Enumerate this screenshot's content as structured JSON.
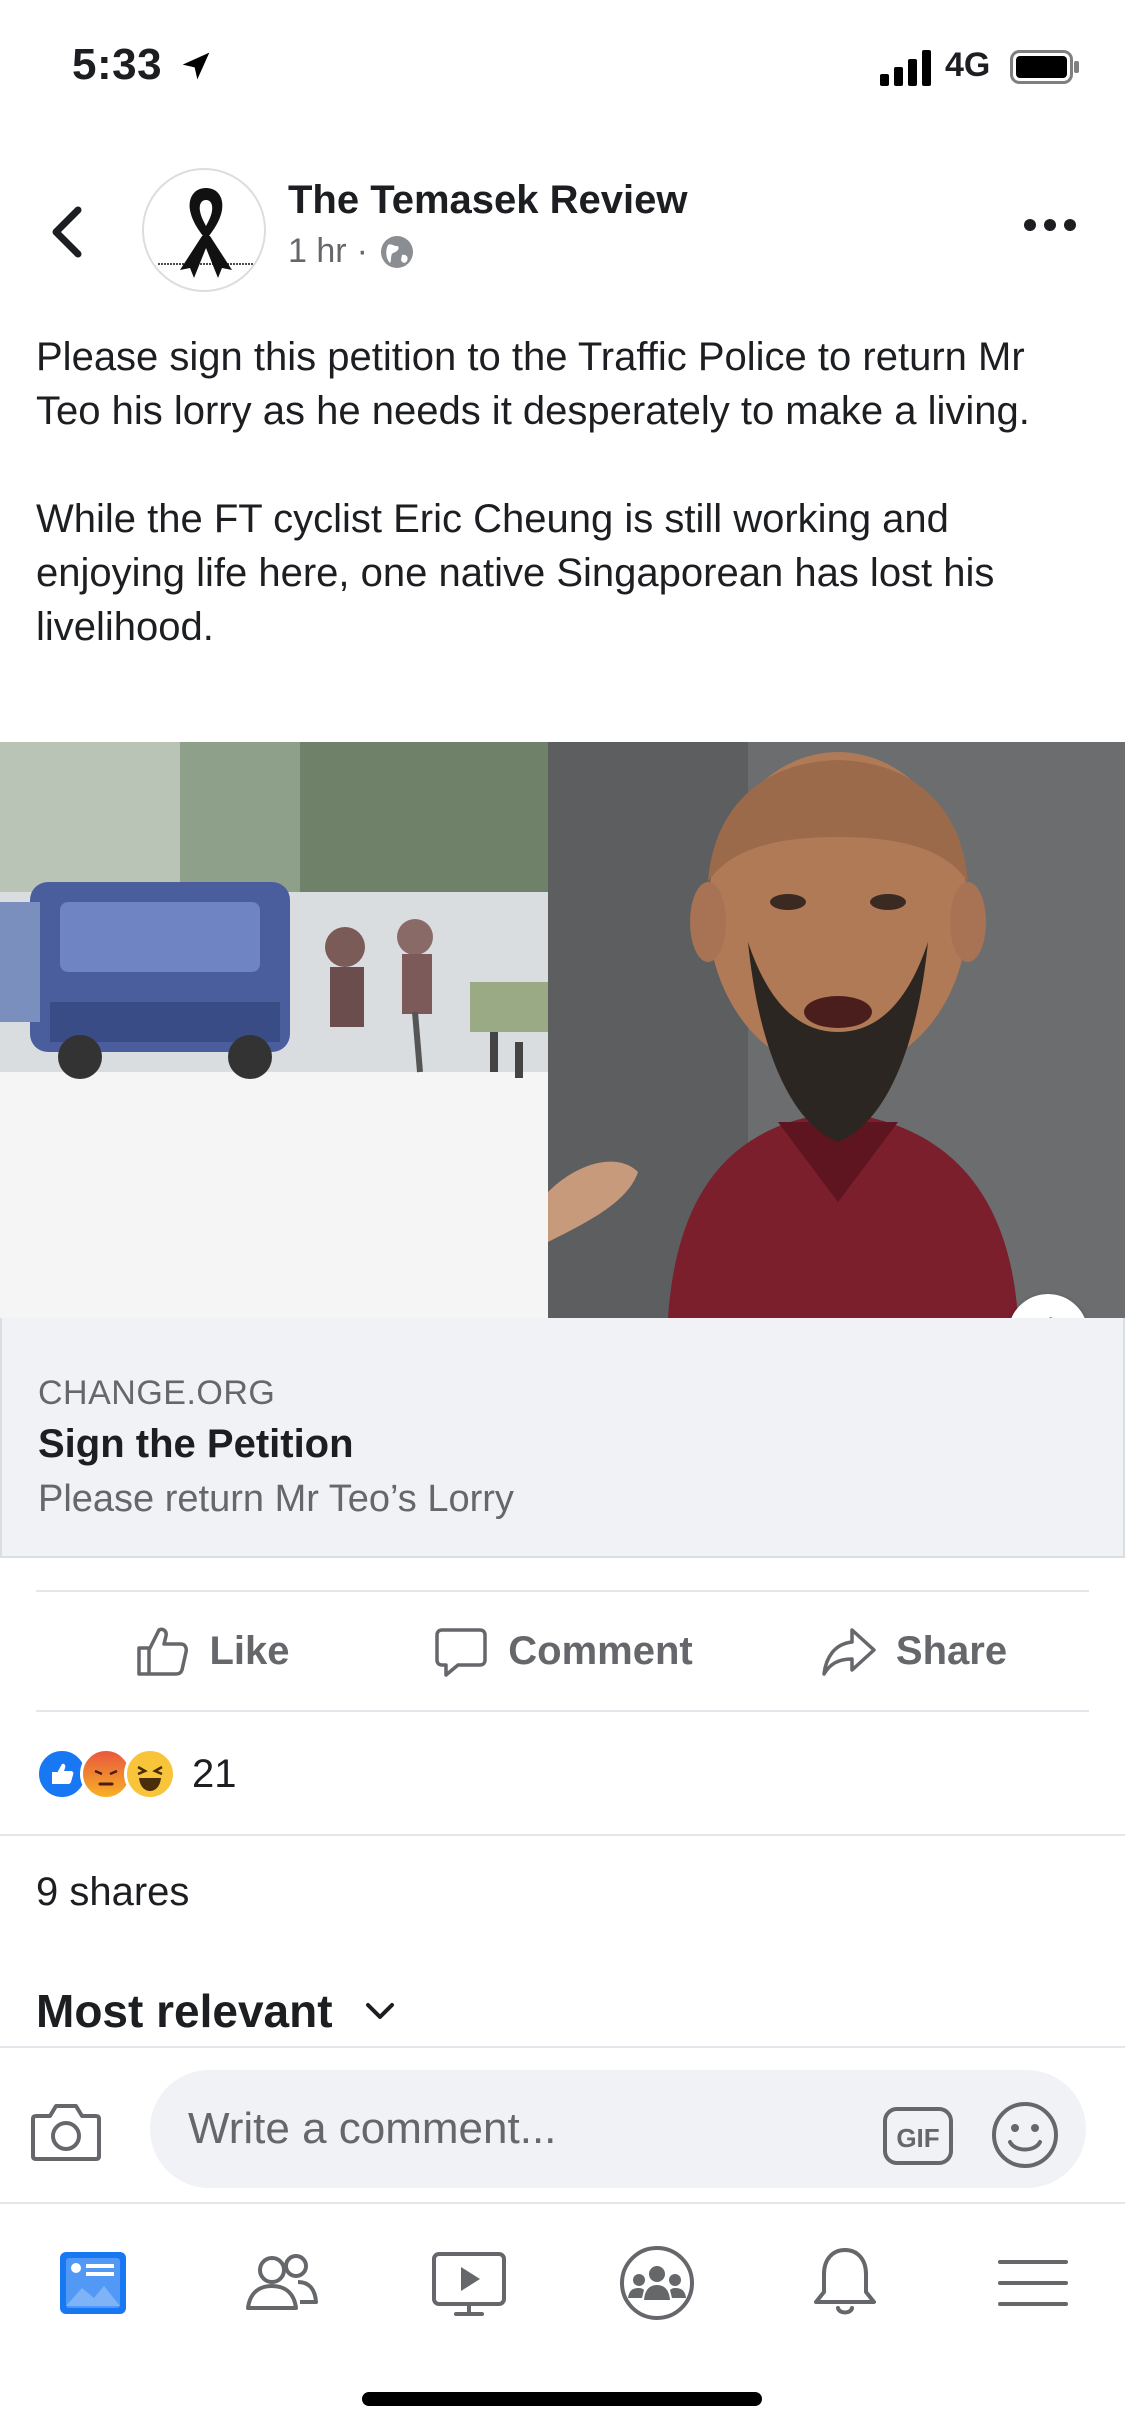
{
  "status_bar": {
    "time": "5:33",
    "network": "4G"
  },
  "post": {
    "author": "The Temasek Review",
    "time": "1 hr",
    "separator": "·",
    "paragraphs": [
      "Please sign this petition to the Traffic Police to return Mr Teo his lorry as he needs it desperately to make a living.",
      "While the FT cyclist Eric Cheung is still working and enjoying life here, one native Singaporean has lost his livelihood."
    ]
  },
  "link_preview": {
    "domain": "CHANGE.ORG",
    "title": "Sign the Petition",
    "description": "Please return Mr Teo’s Lorry",
    "info_label": "i"
  },
  "actions": {
    "like": "Like",
    "comment": "Comment",
    "share": "Share"
  },
  "reactions": {
    "count": "21",
    "types": [
      "like",
      "angry",
      "haha"
    ]
  },
  "shares": "9 shares",
  "sort": {
    "label": "Most relevant"
  },
  "composer": {
    "placeholder": "Write a comment...",
    "gif_label": "GIF"
  },
  "nav": [
    "news-feed-icon",
    "friends-icon",
    "watch-icon",
    "groups-icon",
    "notifications-icon",
    "menu-icon"
  ],
  "colors": {
    "accent": "#1877f2",
    "text": "#1c1e21",
    "secondary": "#65676b",
    "surface": "#f0f2f5"
  }
}
